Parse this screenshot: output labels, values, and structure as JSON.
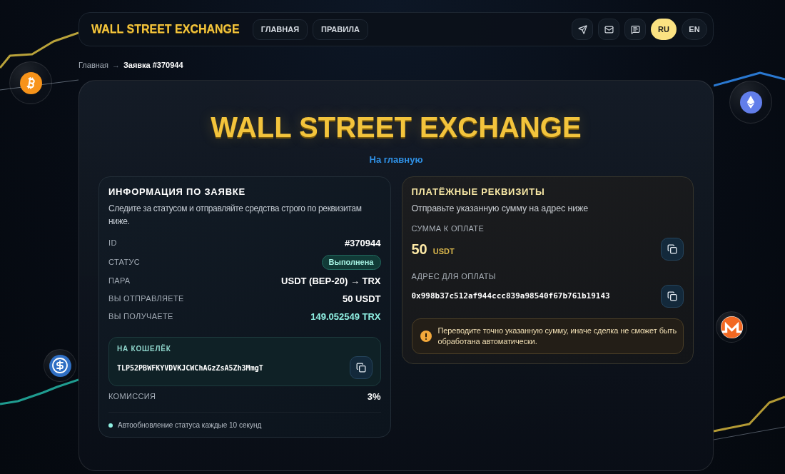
{
  "header": {
    "logo": "WALL STREET EXCHANGE",
    "nav": [
      "ГЛАВНАЯ",
      "ПРАВИЛА"
    ],
    "languages": [
      {
        "label": "RU",
        "selected": true
      },
      {
        "label": "EN",
        "selected": false
      }
    ]
  },
  "breadcrumb": {
    "items": [
      "Главная",
      "Заявка #370944"
    ],
    "separator": "→"
  },
  "hero": {
    "title": "WALL STREET EXCHANGE",
    "link": "На главную"
  },
  "order_info": {
    "title": "ИНФОРМАЦИЯ ПО ЗАЯВКЕ",
    "description": "Следите за статусом и отправляйте средства строго по реквизитам ниже.",
    "rows": [
      {
        "label": "ID",
        "value": "#370944",
        "kind": "text"
      },
      {
        "label": "СТАТУС",
        "value": "Выполнена",
        "kind": "badge"
      },
      {
        "label": "ПАРА",
        "value": "USDT (BEP-20) → TRX",
        "kind": "text"
      },
      {
        "label": "ВЫ ОТПРАВЛЯЕТЕ",
        "value": "50 USDT",
        "kind": "text"
      },
      {
        "label": "ВЫ ПОЛУЧАЕТЕ",
        "value": "149.052549 TRX",
        "kind": "highlight"
      }
    ],
    "wallet": {
      "label": "НА КОШЕЛЁК",
      "address": "TLP52PBWFKYVDVKJCWChAGzZsA5Zh3MmgT"
    },
    "commission": {
      "label": "КОМИССИЯ",
      "value": "3%"
    },
    "auto_update": "Автообновление статуса каждые 10 секунд"
  },
  "payment": {
    "title": "ПЛАТЁЖНЫЕ РЕКВИЗИТЫ",
    "description": "Отправьте указанную сумму на адрес ниже",
    "amount": {
      "label": "СУММА К ОПЛАТЕ",
      "value": "50",
      "currency": "USDT"
    },
    "address": {
      "label": "АДРЕС ДЛЯ ОПЛАТЫ",
      "value": "0x998b37c512af944ccc839a98540f67b761b19143"
    },
    "warning": "Переводите точно указанную сумму, иначе сделка не сможет быть обработана автоматически."
  }
}
